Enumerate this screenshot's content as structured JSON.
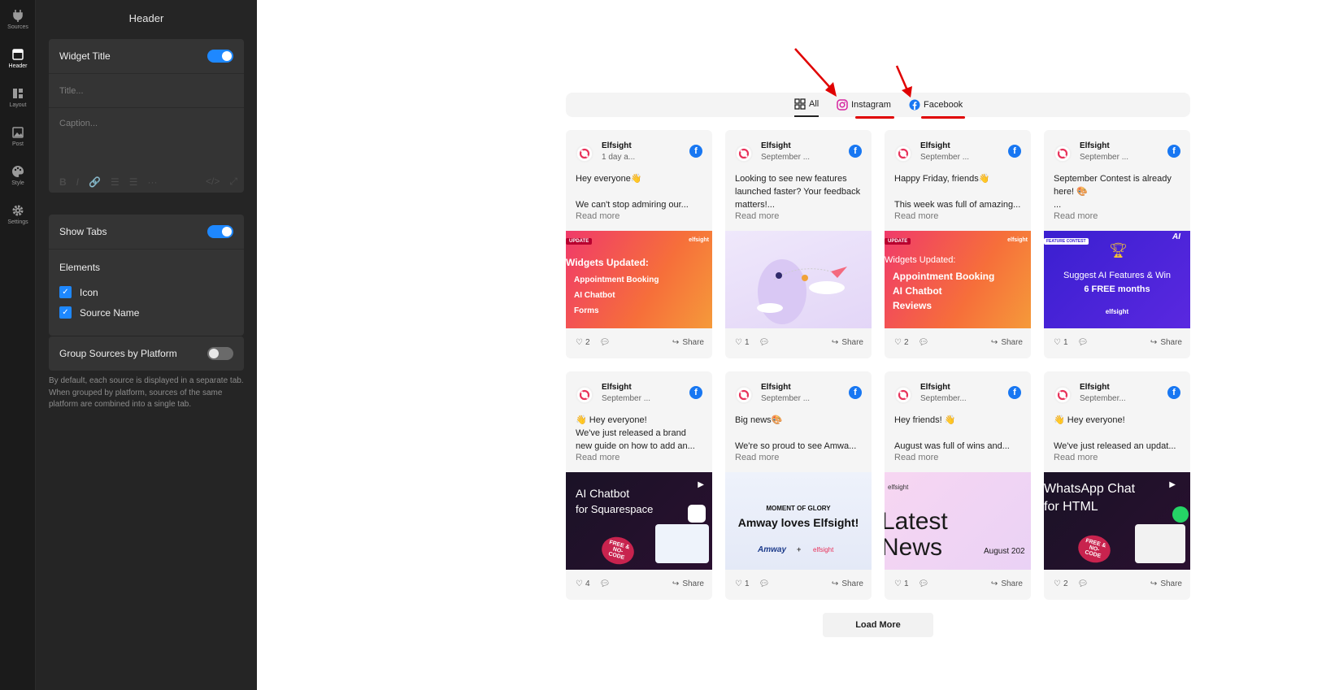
{
  "rail": [
    {
      "label": "Sources",
      "icon": "plug-icon"
    },
    {
      "label": "Header",
      "icon": "header-icon"
    },
    {
      "label": "Layout",
      "icon": "layout-icon"
    },
    {
      "label": "Post",
      "icon": "image-icon"
    },
    {
      "label": "Style",
      "icon": "palette-icon"
    },
    {
      "label": "Settings",
      "icon": "gear-icon"
    }
  ],
  "panel": {
    "title": "Header",
    "widget_title_label": "Widget Title",
    "widget_title_on": true,
    "title_placeholder": "Title...",
    "caption_placeholder": "Caption...",
    "editor_tools": [
      "B",
      "I",
      "🔗",
      "☰",
      "☰",
      "···",
      "</>",
      "⤢"
    ],
    "show_tabs_label": "Show Tabs",
    "show_tabs_on": true,
    "elements_label": "Elements",
    "element_icon": "Icon",
    "element_source": "Source Name",
    "group_label": "Group Sources by Platform",
    "group_on": false,
    "hint": "By default, each source is displayed in a separate tab. When grouped by platform, sources of the same platform are combined into a single tab."
  },
  "tabs": {
    "all": "All",
    "instagram": "Instagram",
    "facebook": "Facebook"
  },
  "colors": {
    "accent": "#1e88ff",
    "annotation": "#e00000",
    "facebook": "#1877f2"
  },
  "posts": [
    {
      "author": "Elfsight",
      "date": "1 day a...",
      "text": "Hey everyone👋\n\nWe can't stop admiring our...",
      "more": "Read more",
      "likes": "2",
      "share": "Share"
    },
    {
      "author": "Elfsight",
      "date": "September ...",
      "text": "Looking to see new features launched faster? Your feedback matters!...",
      "more": "Read more",
      "likes": "1",
      "share": "Share"
    },
    {
      "author": "Elfsight",
      "date": "September ...",
      "text": "Happy Friday, friends👋\n\nThis week was full of amazing...",
      "more": "Read more",
      "likes": "2",
      "share": "Share"
    },
    {
      "author": "Elfsight",
      "date": "September ...",
      "text": "September Contest is already here! 🎨\n...",
      "more": "Read more",
      "likes": "1",
      "share": "Share"
    },
    {
      "author": "Elfsight",
      "date": "September ...",
      "text": "👋 Hey everyone!\nWe've just released a brand new guide on how to add an...",
      "more": "Read more",
      "likes": "4",
      "share": "Share"
    },
    {
      "author": "Elfsight",
      "date": "September ...",
      "text": "Big news🎨\n\nWe're so proud to see Amwa...",
      "more": "Read more",
      "likes": "1",
      "share": "Share"
    },
    {
      "author": "Elfsight",
      "date": "September...",
      "text": "Hey friends! 👋\n\nAugust was full of wins and...",
      "more": "Read more",
      "likes": "1",
      "share": "Share"
    },
    {
      "author": "Elfsight",
      "date": "September...",
      "text": "👋 Hey everyone!\n\nWe've just released an updat...",
      "more": "Read more",
      "likes": "2",
      "share": "Share"
    }
  ],
  "images": {
    "p1": {
      "tag": "UPDATE",
      "title": "Widgets Updated:",
      "items": [
        "Appointment Booking",
        "AI Chatbot",
        "Forms"
      ],
      "brand": "elfsight"
    },
    "p3": {
      "tag": "UPDATE",
      "title": "Widgets Updated:",
      "items": [
        "Appointment Booking",
        "AI Chatbot",
        "Reviews"
      ],
      "brand": "elfsight"
    },
    "p4": {
      "tag": "FEATURE CONTEST",
      "line1": "Suggest AI Features & Win",
      "line2": "6 FREE months",
      "brand": "elfsight",
      "ai": "AI"
    },
    "p5": {
      "line1": "AI Chatbot",
      "line2": "for Squarespace",
      "badge": "FREE & NO-CODE"
    },
    "p6": {
      "line1": "MOMENT OF GLORY",
      "line2": "Amway loves Elfsight!",
      "brand1": "Amway",
      "plus": "+",
      "brand2": "elfsight"
    },
    "p7": {
      "brand": "elfsight",
      "line1": "Latest",
      "line2": "News",
      "month": "August 202"
    },
    "p8": {
      "line1": "WhatsApp Chat",
      "line2": "for HTML",
      "badge": "FREE & NO-CODE"
    }
  },
  "load_more": "Load More"
}
